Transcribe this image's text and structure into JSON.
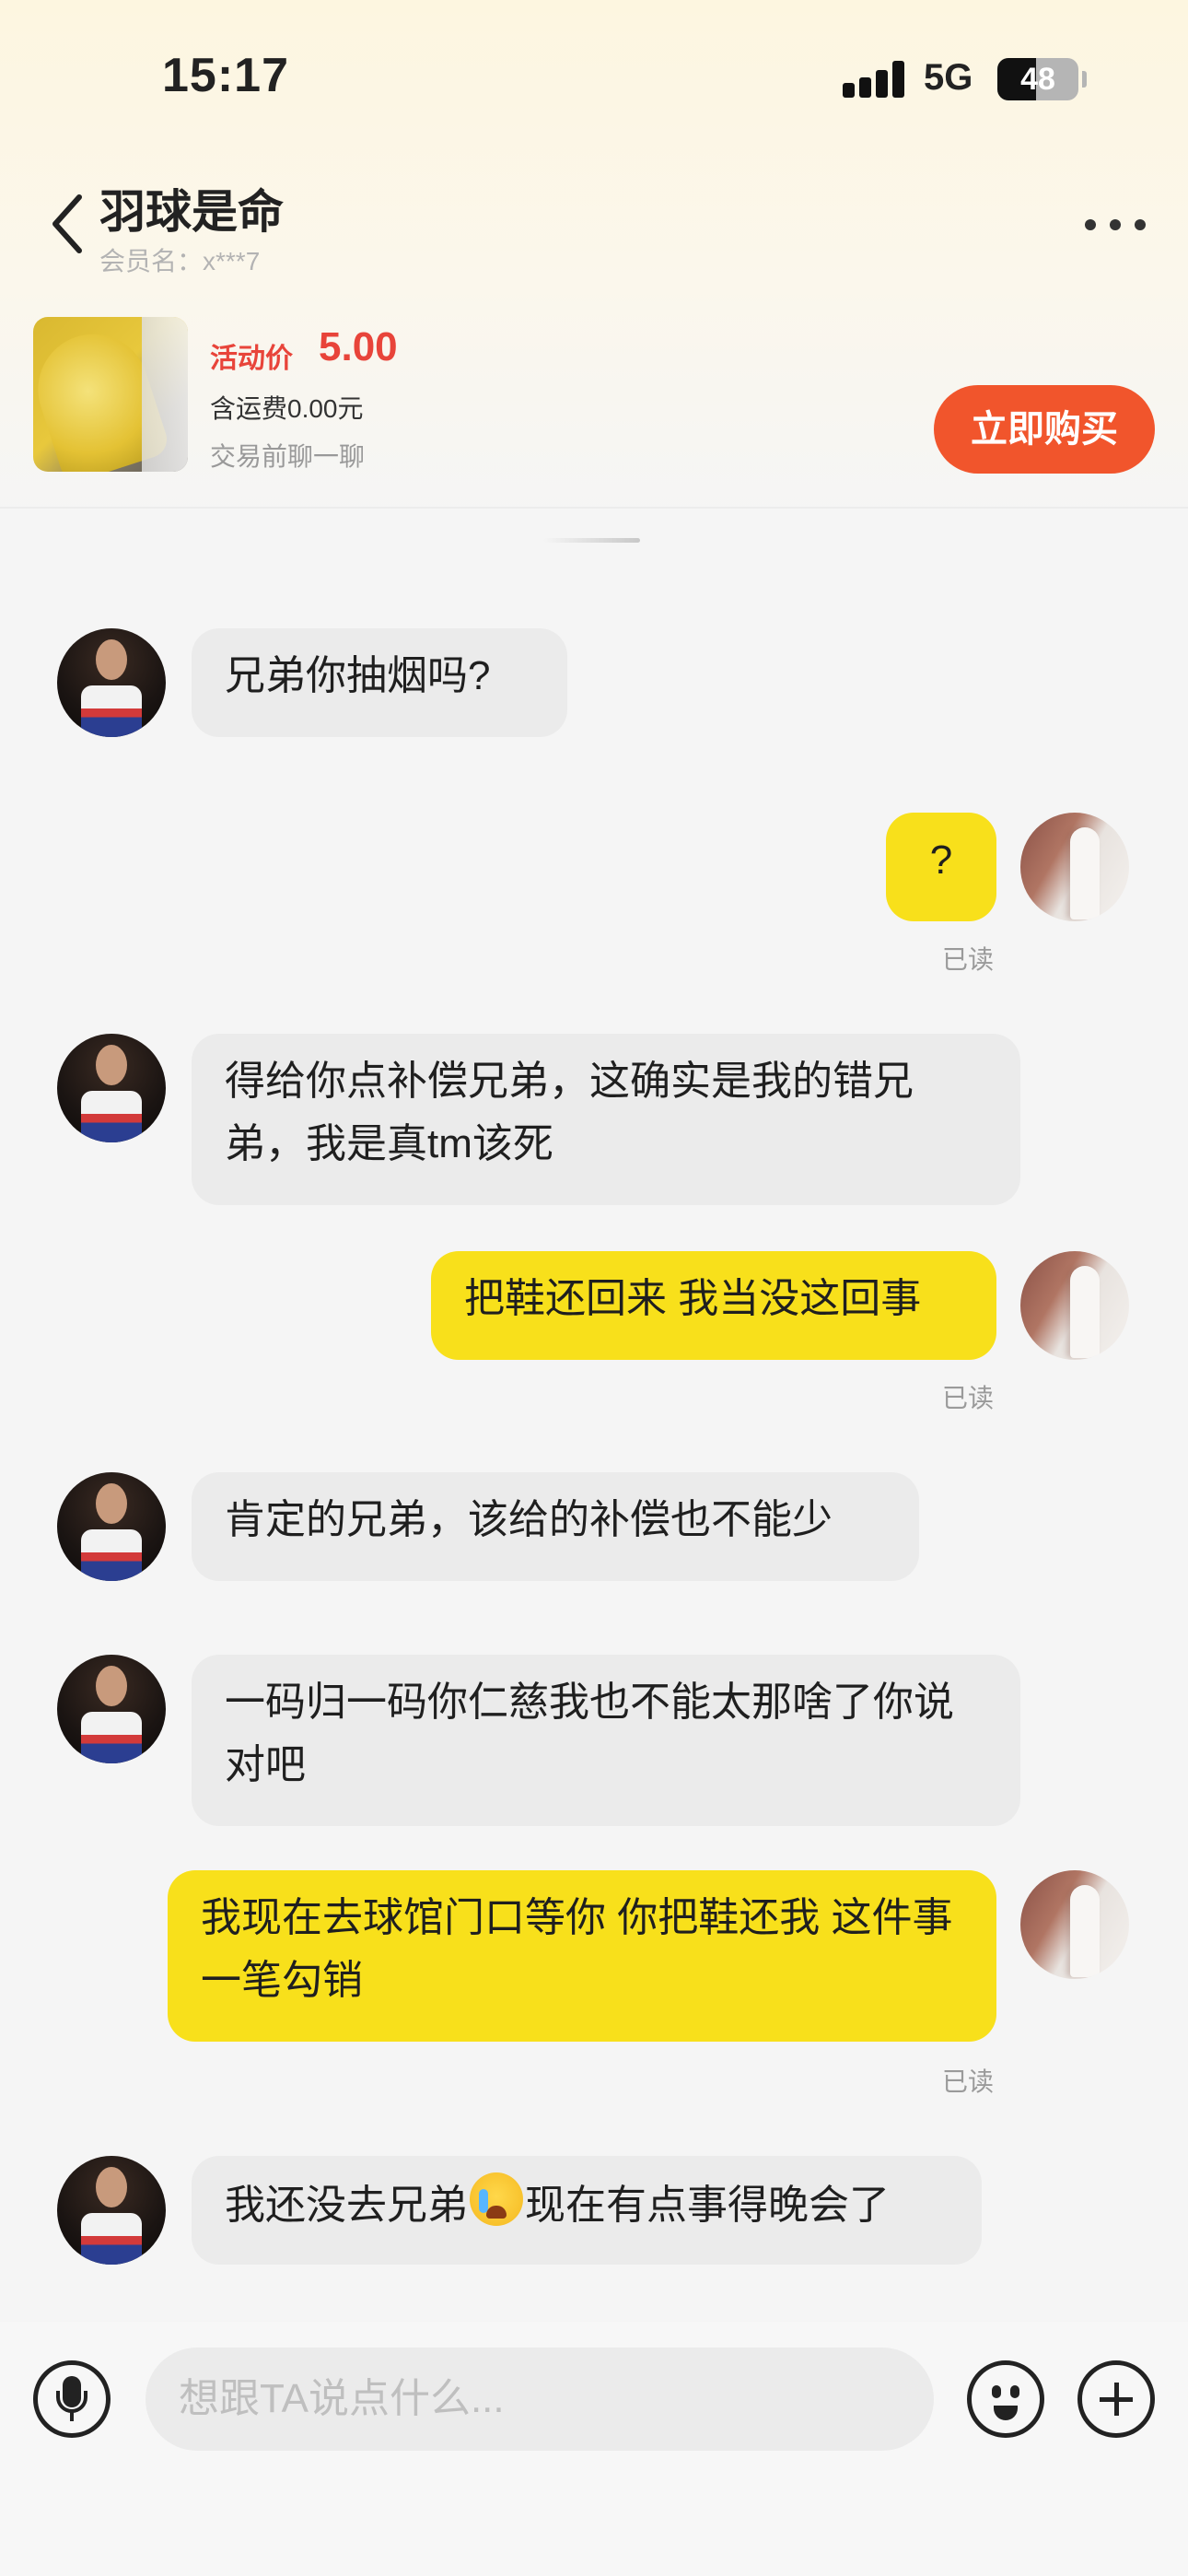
{
  "status_bar": {
    "time": "15:17",
    "network": "5G",
    "battery": "48",
    "battery_level": 0.48
  },
  "header": {
    "title": "羽球是命",
    "member_name": "会员名：x***7"
  },
  "product": {
    "price_tag": "活动价",
    "price": "5.00",
    "shipping": "含运费0.00元",
    "hint": "交易前聊一聊",
    "buy_label": "立即购买"
  },
  "messages": [
    {
      "from": "other",
      "text": "兄弟你抽烟吗?"
    },
    {
      "from": "self",
      "text": "?",
      "read": "已读"
    },
    {
      "from": "other",
      "text": "得给你点补偿兄弟，这确实是我的错兄弟，我是真tm该死"
    },
    {
      "from": "self",
      "text": "把鞋还回来 我当没这回事",
      "read": "已读"
    },
    {
      "from": "other",
      "text": "肯定的兄弟，该给的补偿也不能少"
    },
    {
      "from": "other",
      "text": "一码归一码你仁慈我也不能太那啥了你说对吧"
    },
    {
      "from": "self",
      "text": "我现在去球馆门口等你 你把鞋还我 这件事一笔勾销",
      "read": "已读"
    },
    {
      "from": "other",
      "text_before": "我还没去兄弟",
      "emoji": "crying-face",
      "text_after": "现在有点事得晚会了"
    }
  ],
  "input": {
    "placeholder": "想跟TA说点什么..."
  },
  "colors": {
    "accent": "#f1552c",
    "price": "#e8443a",
    "self_bubble": "#f8e01b",
    "other_bubble": "#ebebeb"
  },
  "icons": [
    "back-icon",
    "more-icon",
    "voice-icon",
    "emoji-icon",
    "add-icon"
  ]
}
